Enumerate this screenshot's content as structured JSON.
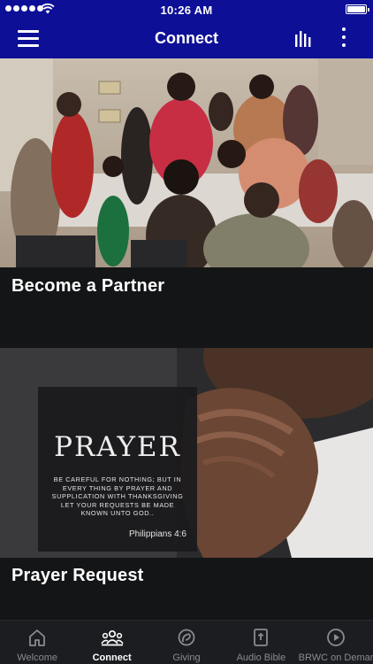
{
  "status": {
    "time": "10:26 AM"
  },
  "header": {
    "title": "Connect",
    "menu_icon": "hamburger-icon",
    "bars_icon": "audio-bars-icon",
    "more_icon": "vertical-ellipsis-icon"
  },
  "cards": [
    {
      "label": "Become a Partner",
      "image": "photo of people gathered at a buffet table"
    },
    {
      "label": "Prayer Request",
      "image": "photo of clasped hands in prayer",
      "overlay": {
        "title": "PRAYER",
        "verse": "BE CAREFUL FOR NOTHING; BUT IN EVERY THING BY PRAYER AND SUPPLICATION WITH THANKSGIVING LET YOUR REQUESTS BE MADE KNOWN UNTO GOD..",
        "reference": "Philippians 4:6"
      }
    }
  ],
  "tabs": [
    {
      "label": "Welcome",
      "icon": "home-icon",
      "active": false
    },
    {
      "label": "Connect",
      "icon": "group-icon",
      "active": true
    },
    {
      "label": "Giving",
      "icon": "hand-heart-icon",
      "active": false
    },
    {
      "label": "Audio Bible",
      "icon": "bible-icon",
      "active": false
    },
    {
      "label": "BRWC on Demand",
      "icon": "play-circle-icon",
      "active": false
    }
  ],
  "colors": {
    "nav_bar": "#0d0f97",
    "background": "#141517",
    "tab_bar": "#1c1d20",
    "tab_active": "#ffffff",
    "tab_inactive": "#8a8b8f"
  }
}
